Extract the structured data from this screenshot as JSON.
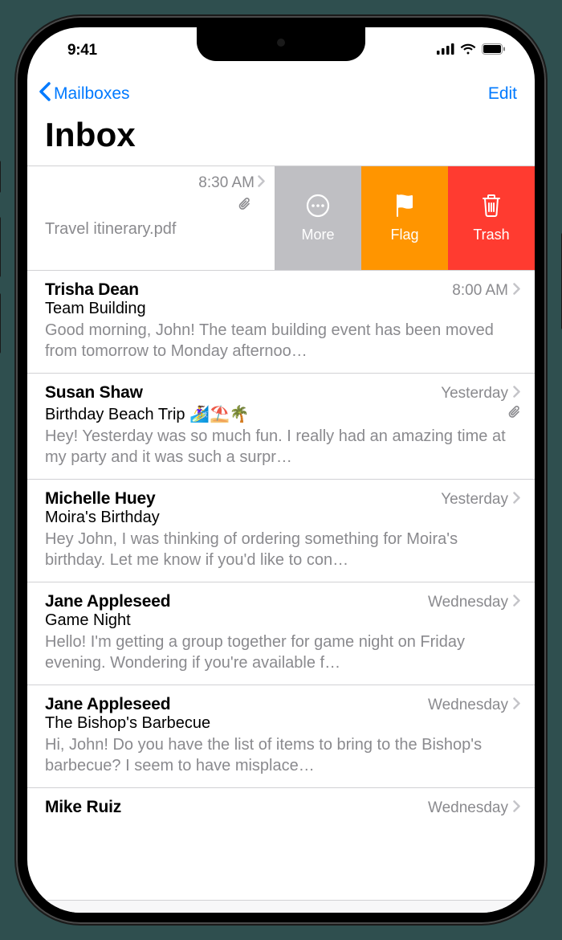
{
  "status": {
    "time": "9:41"
  },
  "nav": {
    "back_label": "Mailboxes",
    "edit_label": "Edit"
  },
  "page": {
    "title": "Inbox"
  },
  "swiped": {
    "time": "8:30 AM",
    "file": "Travel itinerary.pdf",
    "actions": {
      "more": "More",
      "flag": "Flag",
      "trash": "Trash"
    }
  },
  "emails": [
    {
      "sender": "Trisha Dean",
      "time": "8:00 AM",
      "subject": "Team Building",
      "preview": "Good morning, John! The team building event has been moved from tomorrow to Monday afternoo…",
      "attachment": false
    },
    {
      "sender": "Susan Shaw",
      "time": "Yesterday",
      "subject": "Birthday Beach Trip 🏄‍♀️⛱️🌴",
      "preview": "Hey! Yesterday was so much fun. I really had an amazing time at my party and it was such a surpr…",
      "attachment": true
    },
    {
      "sender": "Michelle Huey",
      "time": "Yesterday",
      "subject": "Moira's Birthday",
      "preview": "Hey John, I was thinking of ordering something for Moira's birthday. Let me know if you'd like to con…",
      "attachment": false
    },
    {
      "sender": "Jane Appleseed",
      "time": "Wednesday",
      "subject": "Game Night",
      "preview": "Hello! I'm getting a group together for game night on Friday evening. Wondering if you're available f…",
      "attachment": false
    },
    {
      "sender": "Jane Appleseed",
      "time": "Wednesday",
      "subject": "The Bishop's Barbecue",
      "preview": "Hi, John! Do you have the list of items to bring to the Bishop's barbecue? I seem to have misplace…",
      "attachment": false
    }
  ],
  "last": {
    "sender": "Mike Ruiz",
    "time": "Wednesday"
  }
}
